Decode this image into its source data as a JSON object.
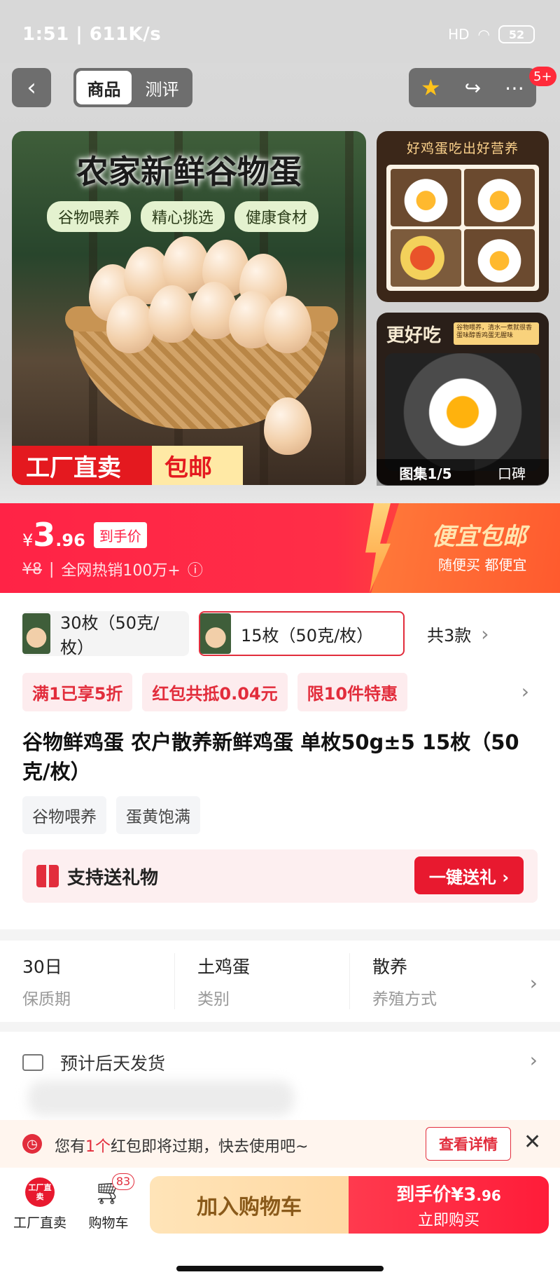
{
  "status_bar": {
    "time": "1:51",
    "speed": "611K/s",
    "signal": "HD",
    "battery": "52"
  },
  "header": {
    "tabs": [
      {
        "label": "商品"
      },
      {
        "label": "测评"
      }
    ],
    "badge": "5+"
  },
  "main_image": {
    "title": "农家新鲜谷物蛋",
    "tags": [
      "谷物喂养",
      "精心挑选",
      "健康食材"
    ],
    "banner_red": "工厂直卖",
    "banner_yellow": "包邮"
  },
  "side_images": {
    "first_title": "好鸡蛋吃出好营养",
    "second_title": "更好吃",
    "second_note": "谷物喂养，清水一煮就很香 蛋味醇香鸡蛋无腥味",
    "gallery_label": "图集1/5",
    "reviews_label": "口碑"
  },
  "price": {
    "currency": "¥",
    "integer": "3",
    "decimal": ".96",
    "tag": "到手价",
    "original": "¥8",
    "sales": "全网热销100万+",
    "promo_title": "便宜包邮",
    "promo_sub": "随便买 都便宜"
  },
  "variants": {
    "items": [
      {
        "label": "30枚（50克/枚）",
        "selected": false
      },
      {
        "label": "15枚（50克/枚）",
        "selected": true
      }
    ],
    "count_label": "共3款"
  },
  "promotions": [
    "满1已享5折",
    "红包共抵0.04元",
    "限10件特惠"
  ],
  "product": {
    "title": "谷物鲜鸡蛋 农户散养新鲜鸡蛋 单枚50g±5 15枚（50克/枚）",
    "tags": [
      "谷物喂养",
      "蛋黄饱满"
    ]
  },
  "gift": {
    "text": "支持送礼物",
    "button": "一键送礼 ›"
  },
  "specs": [
    {
      "value": "30日",
      "label": "保质期"
    },
    {
      "value": "土鸡蛋",
      "label": "类别"
    },
    {
      "value": "散养",
      "label": "养殖方式"
    }
  ],
  "shipping": {
    "text": "预计后天发货"
  },
  "notice": {
    "prefix": "您有",
    "count": "1个",
    "suffix": "红包即将过期，快去使用吧~",
    "button": "查看详情"
  },
  "bottom_bar": {
    "factory_icon_text": "工厂直卖",
    "factory_label": "工厂直卖",
    "cart_label": "购物车",
    "cart_count": "83",
    "add_cart": "加入购物车",
    "buy_price_label": "到手价¥",
    "buy_price_int": "3",
    "buy_price_dec": ".96",
    "buy_now": "立即购买"
  },
  "colors": {
    "accent": "#e22d3c",
    "price_red": "#ff2346",
    "gold": "#ffc21a"
  }
}
